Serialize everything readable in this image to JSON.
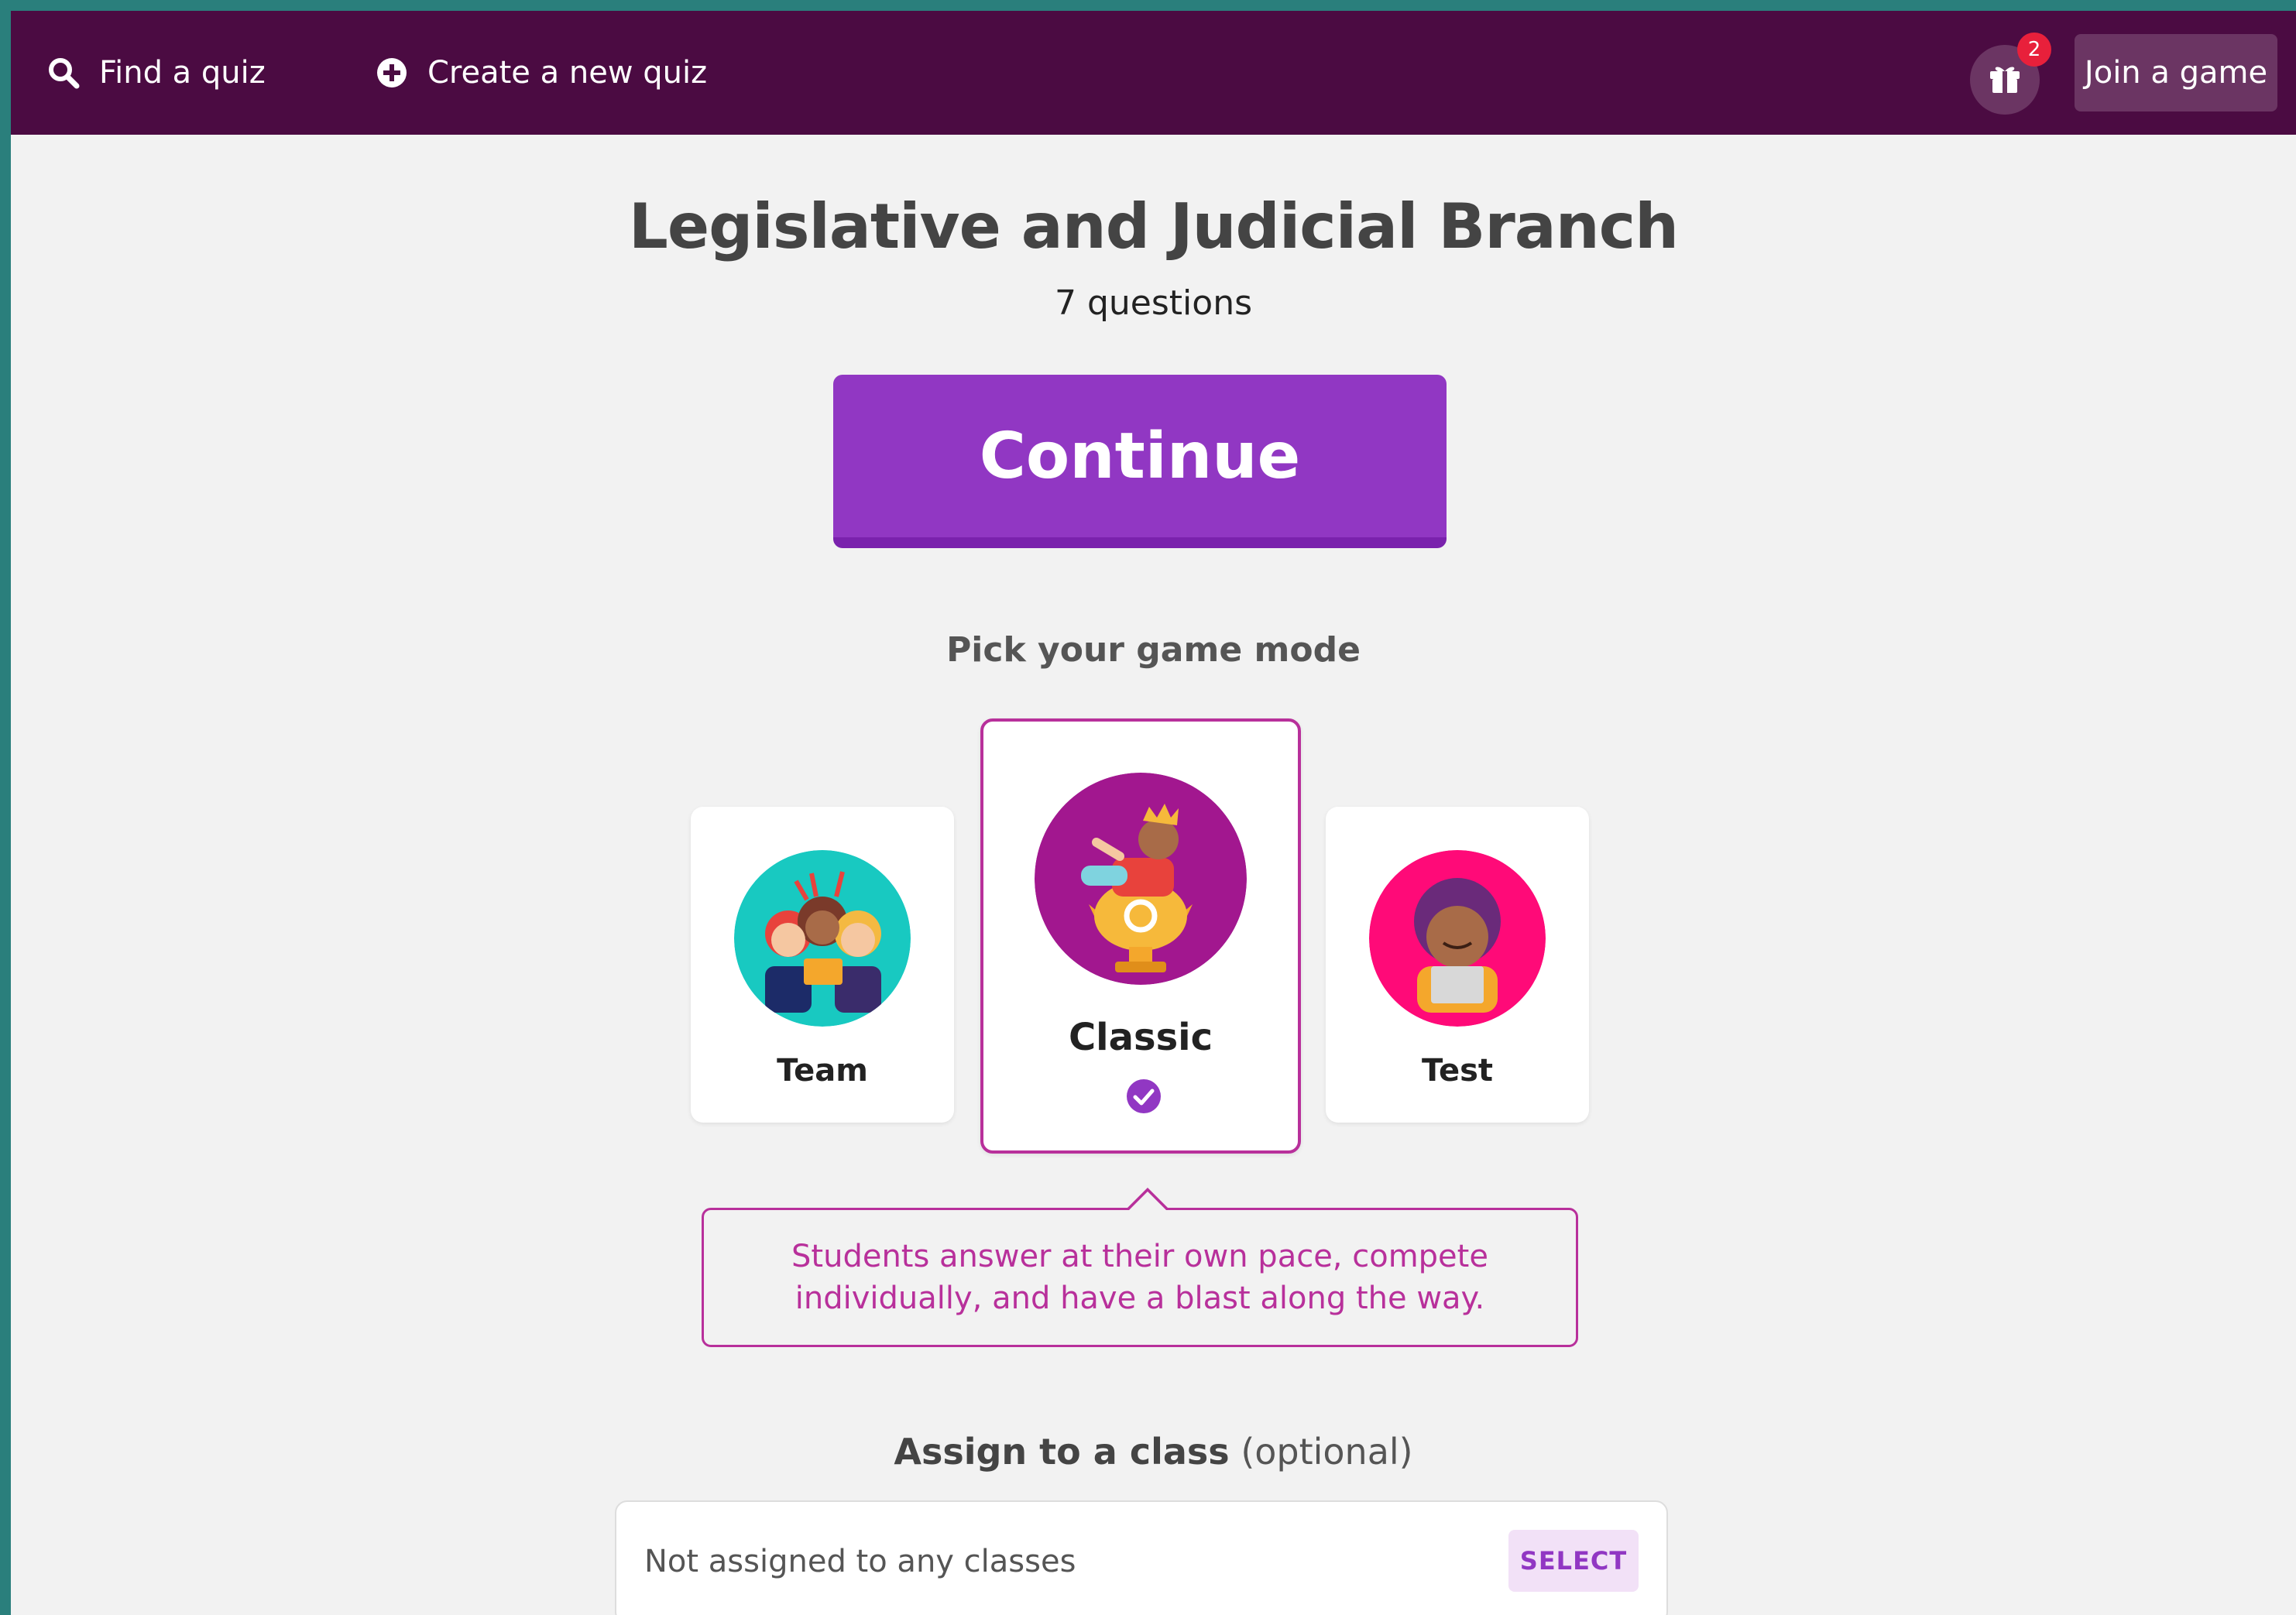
{
  "nav": {
    "find_quiz_label": "Find a quiz",
    "create_quiz_label": "Create a new quiz",
    "gift_badge_count": "2",
    "join_game_label": "Join a game"
  },
  "quiz": {
    "title": "Legislative and Judicial Branch",
    "question_count": "7 questions"
  },
  "continue_label": "Continue",
  "game_mode": {
    "heading": "Pick your game mode",
    "modes": [
      {
        "label": "Team",
        "color": "#18c9c1"
      },
      {
        "label": "Classic",
        "color": "#a2178f",
        "selected": true
      },
      {
        "label": "Test",
        "color": "#ff0a78"
      }
    ],
    "description": "Students answer at their own pace, compete individually, and have a blast along the way."
  },
  "assign": {
    "label_bold": "Assign to a class",
    "label_optional": "(optional)",
    "current_value": "Not assigned to any classes",
    "select_label": "SELECT"
  },
  "colors": {
    "topbar": "#4b0b42",
    "accent": "#9137c3",
    "highlight": "#b8309b"
  }
}
